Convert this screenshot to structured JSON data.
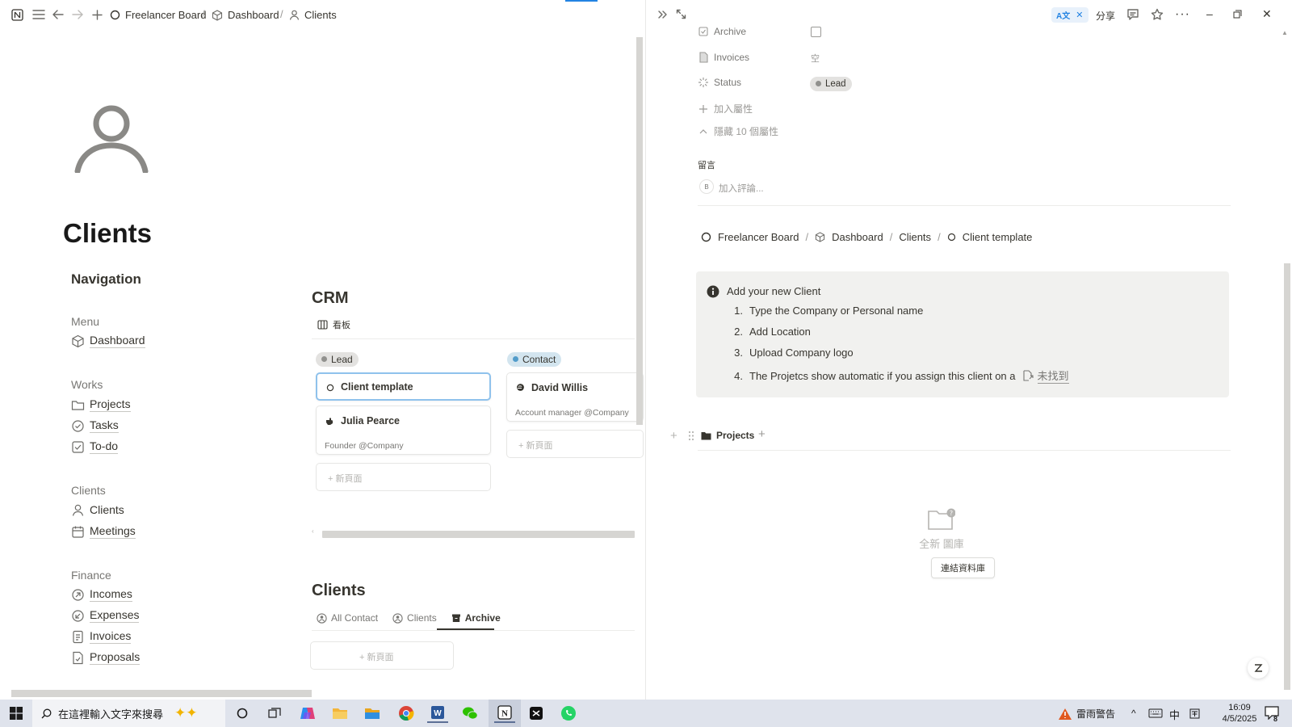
{
  "topbar": {
    "crumbs": [
      "Freelancer Board",
      "Dashboard",
      "Clients"
    ],
    "separators": [
      "/",
      "/"
    ]
  },
  "page": {
    "title": "Clients",
    "navigation_heading": "Navigation",
    "sections": [
      {
        "title": "Menu",
        "items": [
          "Dashboard"
        ]
      },
      {
        "title": "Works",
        "items": [
          "Projects",
          "Tasks",
          "To-do"
        ]
      },
      {
        "title": "Clients",
        "items": [
          "Clients",
          "Meetings"
        ]
      },
      {
        "title": "Finance",
        "items": [
          "Incomes",
          "Expenses",
          "Invoices",
          "Proposals"
        ]
      }
    ]
  },
  "crm": {
    "title": "CRM",
    "view_label": "看板",
    "columns": [
      {
        "name": "Lead",
        "color": "#9b9a97",
        "cards": [
          {
            "title": "Client template",
            "subtitle": ""
          },
          {
            "title": "Julia Pearce",
            "subtitle": "Founder @Company"
          }
        ],
        "new_label": "+ 新頁面"
      },
      {
        "name": "Contact",
        "color": "#529cca",
        "cards": [
          {
            "title": "David Willis",
            "subtitle": "Account manager @Company"
          }
        ],
        "new_label": "+ 新頁面"
      }
    ]
  },
  "clients_db": {
    "title": "Clients",
    "tabs": [
      "All Contact",
      "Clients",
      "Archive"
    ],
    "active_tab": "Archive",
    "new_label": "+ 新頁面"
  },
  "right": {
    "header_actions": {
      "translate": "A文",
      "share": "分享"
    },
    "properties": [
      {
        "name": "Archive",
        "value": ""
      },
      {
        "name": "Invoices",
        "value": "空"
      },
      {
        "name": "Status",
        "value": "Lead"
      }
    ],
    "add_property": "加入屬性",
    "hidden_properties": "隱藏 10 個屬性",
    "comments_label": "留言",
    "comment_placeholder": "加入評論...",
    "avatar_letter": "B",
    "breadcrumb": [
      "Freelancer Board",
      "Dashboard",
      "Clients",
      "Client template"
    ],
    "callout": {
      "heading": "Add your new Client",
      "steps": [
        "Type the Company or Personal name",
        "Add Location",
        "Upload Company logo",
        "The Projetcs show automatic if you assign this client on a"
      ],
      "link_text": "未找到"
    },
    "linked_db": {
      "name": "Projects",
      "empty_text": "全新 圖庫",
      "connect_button": "連結資料庫"
    }
  },
  "taskbar": {
    "search_placeholder": "在這裡輸入文字來搜尋",
    "weather": "雷雨警告",
    "ime": "中",
    "time": "16:09",
    "date": "4/5/2025",
    "notification_count": "8"
  }
}
